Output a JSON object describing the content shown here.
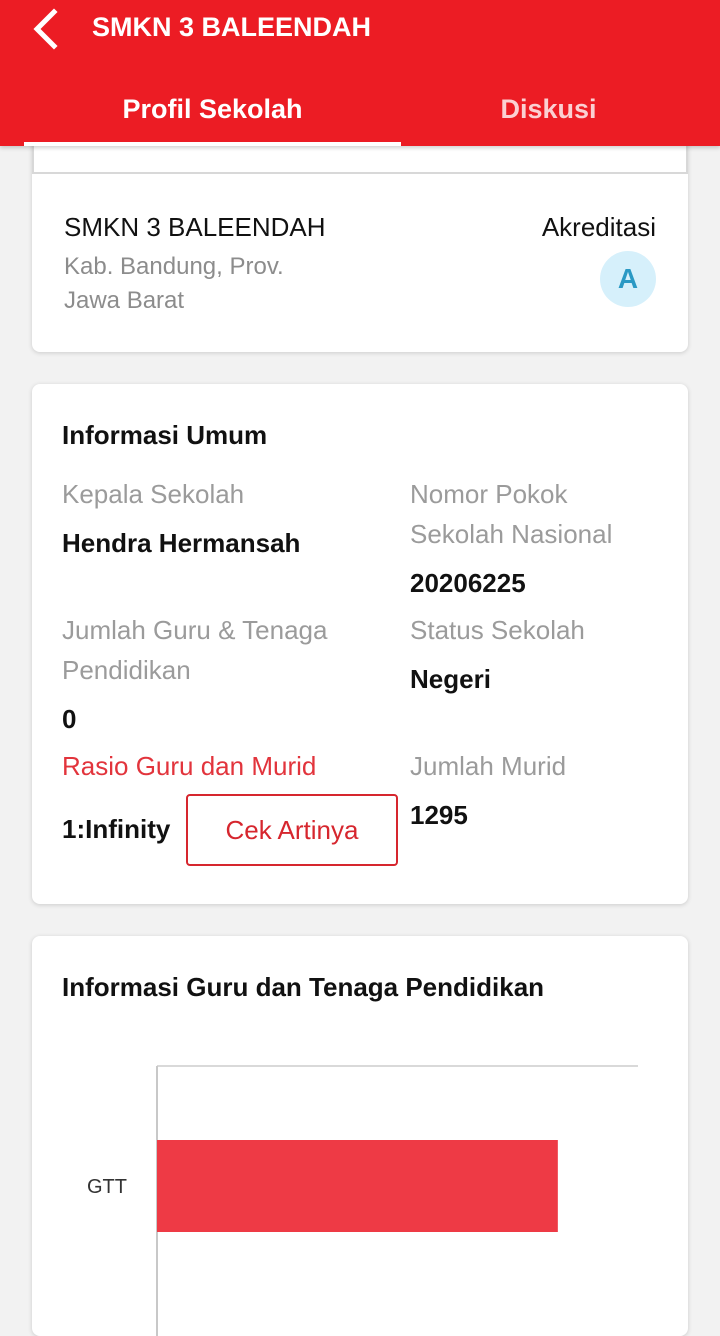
{
  "header": {
    "title": "SMKN 3 BALEENDAH",
    "background": "#ec1c24"
  },
  "tabs": [
    {
      "label": "Profil Sekolah",
      "active": true
    },
    {
      "label": "Diskusi",
      "active": false
    }
  ],
  "school": {
    "name": "SMKN 3 BALEENDAH",
    "location": "Kab. Bandung, Prov. Jawa Barat",
    "accreditation_label": "Akreditasi",
    "accreditation_grade": "A"
  },
  "info": {
    "title": "Informasi Umum",
    "principal_label": "Kepala Sekolah",
    "principal_value": "Hendra Hermansah",
    "npsn_label": "Nomor Pokok Sekolah Nasional",
    "npsn_value": "20206225",
    "teachers_label": "Jumlah Guru & Tenaga Pendidikan",
    "teachers_value": "0",
    "status_label": "Status Sekolah",
    "status_value": "Negeri",
    "ratio_label": "Rasio Guru dan Murid",
    "ratio_value": "1:Infinity",
    "ratio_button": "Cek Artinya",
    "students_label": "Jumlah Murid",
    "students_value": "1295"
  },
  "guru_section": {
    "title": "Informasi Guru dan Tenaga Pendidikan"
  },
  "chart_data": {
    "type": "bar",
    "orientation": "horizontal",
    "categories": [
      "GTT"
    ],
    "values": [
      1
    ],
    "xlim": [
      0,
      1.2
    ],
    "bar_color": "#ee3a45",
    "grid": true
  }
}
